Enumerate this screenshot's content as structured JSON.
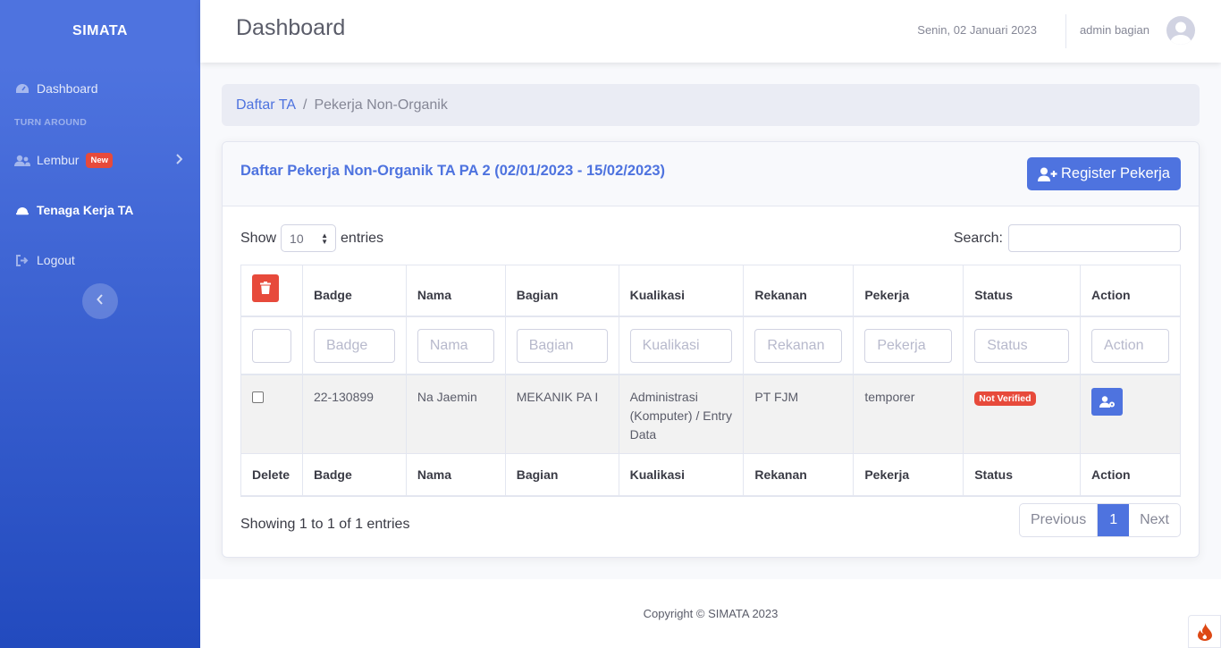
{
  "sidebar": {
    "brand": "SIMATA",
    "heading": "TURN AROUND",
    "items": [
      {
        "label": "Dashboard",
        "icon": "tachometer-icon"
      },
      {
        "label": "Lembur",
        "icon": "users-icon",
        "badge": "New"
      },
      {
        "label": "Tenaga Kerja TA",
        "icon": "hard-hat-icon"
      },
      {
        "label": "Logout",
        "icon": "sign-out-icon"
      }
    ]
  },
  "topbar": {
    "title": "Dashboard",
    "date": "Senin, 02 Januari 2023",
    "user": "admin bagian"
  },
  "breadcrumb": {
    "parent": "Daftar TA",
    "separator": "/",
    "current": "Pekerja Non-Organik"
  },
  "card": {
    "title": "Daftar Pekerja Non-Organik TA PA 2 (02/01/2023 - 15/02/2023)",
    "register_label": "Register Pekerja"
  },
  "datatable": {
    "show_label": "Show",
    "entries_label": "entries",
    "page_length": "10",
    "search_label": "Search:",
    "search_value": "",
    "columns": [
      "Badge",
      "Nama",
      "Bagian",
      "Kualikasi",
      "Rekanan",
      "Pekerja",
      "Status",
      "Action"
    ],
    "footer_first": "Delete",
    "filters": [
      "Badge",
      "Nama",
      "Bagian",
      "Kualikasi",
      "Rekanan",
      "Pekerja",
      "Status",
      "Action"
    ],
    "rows": [
      {
        "badge": "22-130899",
        "nama": "Na Jaemin",
        "bagian": "MEKANIK PA I",
        "kualikasi": "Administrasi (Komputer) / Entry Data",
        "rekanan": "PT FJM",
        "pekerja": "temporer",
        "status": "Not Verified"
      }
    ],
    "info": "Showing 1 to 1 of 1 entries",
    "pagination": {
      "previous": "Previous",
      "current": "1",
      "next": "Next"
    }
  },
  "footer": {
    "copyright": "Copyright © SIMATA 2023"
  },
  "colors": {
    "primary": "#4e73df",
    "danger": "#e74a3b",
    "sidebar_dark": "#224abe"
  }
}
